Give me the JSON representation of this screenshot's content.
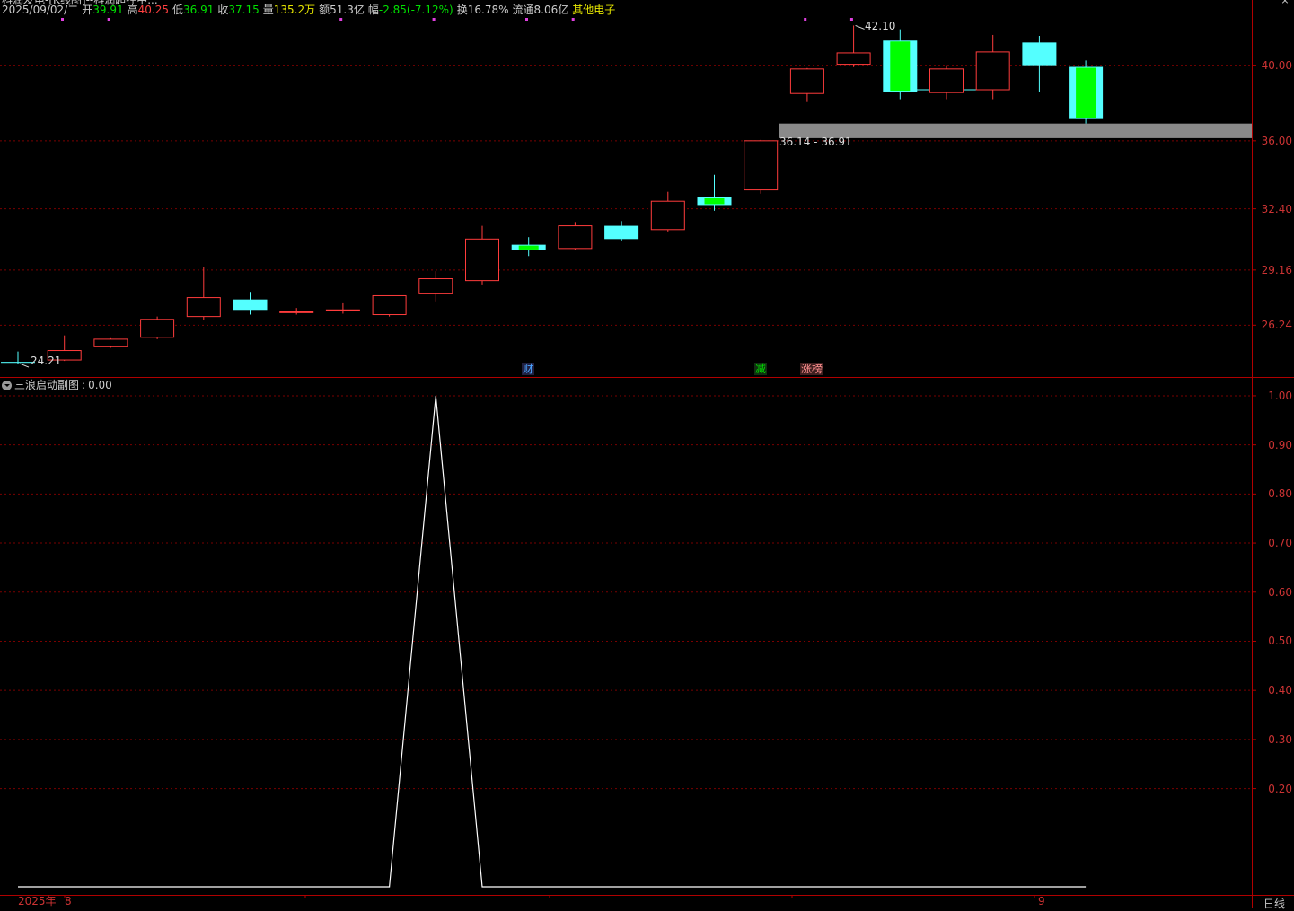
{
  "window": {
    "title": "科润发电-[K线图]--科润超控中...",
    "close_glyph": "×"
  },
  "info_bar": [
    {
      "label": "2025/09/02/二",
      "value": "",
      "color": "#cccccc"
    },
    {
      "label": "开",
      "value": "39.91",
      "color": "#00e000"
    },
    {
      "label": "高",
      "value": "40.25",
      "color": "#ff4040"
    },
    {
      "label": "低",
      "value": "36.91",
      "color": "#00e000"
    },
    {
      "label": "收",
      "value": "37.15",
      "color": "#00e000"
    },
    {
      "label": "量",
      "value": "135.2万",
      "color": "#e6e600"
    },
    {
      "label": "额",
      "value": "51.3亿",
      "color": "#cccccc"
    },
    {
      "label": "幅",
      "value": "-2.85(-7.12%)",
      "color": "#00e000"
    },
    {
      "label": "换",
      "value": "16.78%",
      "color": "#cccccc"
    },
    {
      "label": "流通",
      "value": "8.06亿",
      "color": "#cccccc"
    },
    {
      "label": "",
      "value": "其他电子",
      "color": "#e6e600"
    }
  ],
  "indicator": {
    "name": "三浪启动副图",
    "value_label": "0.00"
  },
  "annotations": {
    "high_label": "42.10",
    "low_label": "24.21",
    "range_label": "36.14 - 36.91"
  },
  "badges": [
    {
      "text": "财",
      "color": "#4aa3ff",
      "bg": "#202040"
    },
    {
      "text": "减",
      "color": "#00e000",
      "bg": "#103010"
    },
    {
      "text": "涨榜",
      "color": "#ff9090",
      "bg": "#402020"
    }
  ],
  "x_axis": {
    "year_label": "2025年",
    "month_labels": [
      "8",
      "9"
    ]
  },
  "period_label": "日线",
  "price_axis": [
    "40.00",
    "36.00",
    "32.40",
    "29.16",
    "26.24"
  ],
  "indicator_axis": [
    "1.00",
    "0.90",
    "0.80",
    "0.70",
    "0.60",
    "0.50",
    "0.40",
    "0.30",
    "0.20"
  ],
  "colors": {
    "up": "#ff3c3c",
    "down": "#54ffff",
    "highlight": "#00ff00",
    "grid": "#7a0000",
    "zone": "#8a8a8a"
  },
  "chart_data": {
    "type": "candlestick",
    "ylim": [
      23.5,
      42.5
    ],
    "candles": [
      {
        "o": 24.3,
        "h": 24.85,
        "l": 24.21,
        "c": 24.25
      },
      {
        "o": 24.4,
        "h": 25.7,
        "l": 24.35,
        "c": 24.9
      },
      {
        "o": 25.1,
        "h": 25.55,
        "l": 25.05,
        "c": 25.5
      },
      {
        "o": 25.6,
        "h": 26.7,
        "l": 25.5,
        "c": 26.55
      },
      {
        "o": 26.7,
        "h": 29.3,
        "l": 26.5,
        "c": 27.7
      },
      {
        "o": 27.6,
        "h": 28.0,
        "l": 26.8,
        "c": 27.05
      },
      {
        "o": 26.95,
        "h": 27.15,
        "l": 26.8,
        "c": 26.95
      },
      {
        "o": 27.05,
        "h": 27.4,
        "l": 26.85,
        "c": 27.05
      },
      {
        "o": 26.8,
        "h": 27.8,
        "l": 26.7,
        "c": 27.8
      },
      {
        "o": 27.9,
        "h": 29.1,
        "l": 27.5,
        "c": 28.7
      },
      {
        "o": 28.6,
        "h": 31.5,
        "l": 28.4,
        "c": 30.8
      },
      {
        "o": 30.5,
        "h": 30.9,
        "l": 29.9,
        "c": 30.2
      },
      {
        "o": 30.3,
        "h": 31.7,
        "l": 30.2,
        "c": 31.5
      },
      {
        "o": 31.5,
        "h": 31.75,
        "l": 30.7,
        "c": 30.8
      },
      {
        "o": 31.3,
        "h": 33.3,
        "l": 31.2,
        "c": 32.8
      },
      {
        "o": 33.0,
        "h": 34.2,
        "l": 32.3,
        "c": 32.6
      },
      {
        "o": 33.4,
        "h": 36.05,
        "l": 33.2,
        "c": 36.0
      },
      {
        "o": 38.5,
        "h": 39.85,
        "l": 38.05,
        "c": 39.8
      },
      {
        "o": 40.05,
        "h": 42.1,
        "l": 39.9,
        "c": 40.65
      },
      {
        "o": 41.3,
        "h": 41.9,
        "l": 38.2,
        "c": 38.6
      },
      {
        "o": 38.55,
        "h": 40.0,
        "l": 38.2,
        "c": 39.8
      },
      {
        "o": 38.7,
        "h": 41.6,
        "l": 38.2,
        "c": 40.7
      },
      {
        "o": 41.2,
        "h": 41.55,
        "l": 38.6,
        "c": 40.0
      },
      {
        "o": 39.91,
        "h": 40.25,
        "l": 36.91,
        "c": 37.15
      }
    ],
    "highlight_candles": [
      11,
      15,
      19,
      23
    ],
    "support_zone": [
      36.14,
      36.91
    ],
    "support_line": 38.7,
    "indicator": {
      "ylim": [
        0,
        1.02
      ],
      "values": [
        0,
        0,
        0,
        0,
        0,
        0,
        0,
        0,
        0,
        1,
        0,
        0,
        0,
        0,
        0,
        0,
        0,
        0,
        0,
        0,
        0,
        0,
        0,
        0
      ]
    }
  }
}
